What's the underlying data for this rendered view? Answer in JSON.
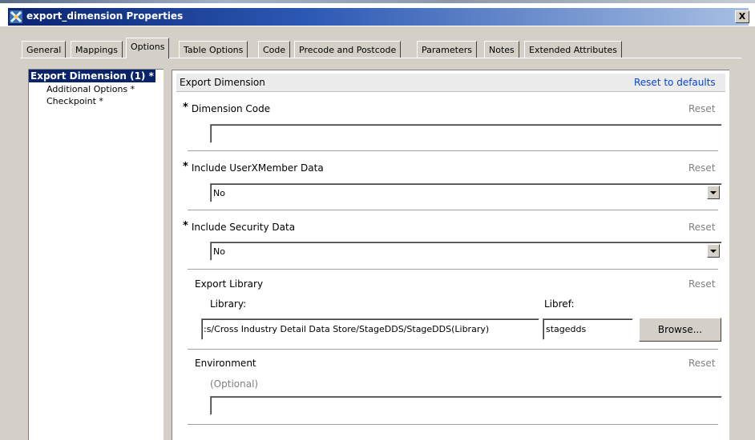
{
  "window": {
    "title": "export_dimension Properties",
    "close_label": "X"
  },
  "tabs": [
    "General",
    "Mappings",
    "Options",
    "Table Options",
    "Code",
    "Precode and Postcode",
    "Parameters",
    "Notes",
    "Extended Attributes"
  ],
  "active_tab": "Options",
  "tree": {
    "selected": "Export Dimension (1) *",
    "children": [
      "Additional Options *",
      "Checkpoint *"
    ]
  },
  "section": {
    "title": "Export Dimension",
    "reset_all": "Reset to defaults"
  },
  "fields": {
    "required_marker": "*",
    "reset_label": "Reset",
    "dimension_code": {
      "label": "Dimension Code",
      "value": ""
    },
    "include_userxmember": {
      "label": "Include UserXMember Data",
      "value": "No"
    },
    "include_security": {
      "label": "Include Security Data",
      "value": "No"
    },
    "export_library": {
      "label": "Export Library",
      "library_label": "Library:",
      "library_value": ":s/Cross Industry Detail Data Store/StageDDS/StageDDS(Library)",
      "libref_label": "Libref:",
      "libref_value": "stagedds",
      "browse_label": "Browse..."
    },
    "environment": {
      "label": "Environment",
      "hint": "(Optional)",
      "value": ""
    }
  }
}
